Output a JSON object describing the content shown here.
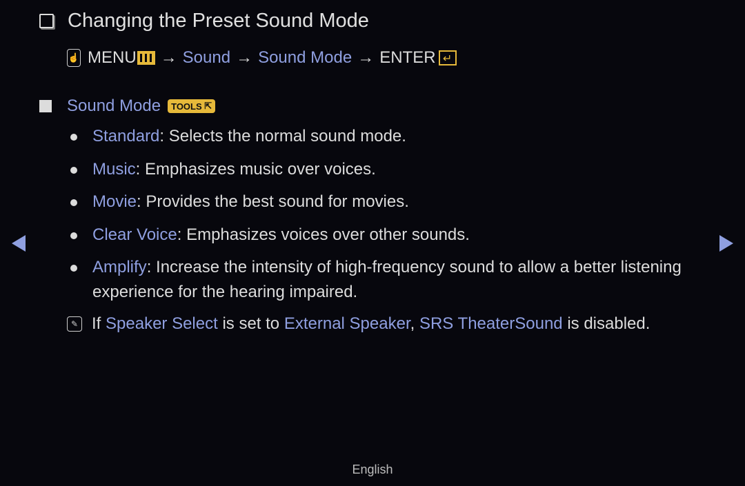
{
  "title": "Changing the Preset Sound Mode",
  "path": {
    "menu": "MENU",
    "arrow": "→",
    "step1": "Sound",
    "step2": "Sound Mode",
    "enter": "ENTER"
  },
  "section": {
    "label": "Sound Mode",
    "tools_badge": "TOOLS"
  },
  "items": [
    {
      "term": "Standard",
      "desc": ": Selects the normal sound mode."
    },
    {
      "term": "Music",
      "desc": ": Emphasizes music over voices."
    },
    {
      "term": "Movie",
      "desc": ": Provides the best sound for movies."
    },
    {
      "term": "Clear Voice",
      "desc": ": Emphasizes voices over other sounds."
    },
    {
      "term": "Amplify",
      "desc": ": Increase the intensity of high-frequency sound to allow a better listening experience for the hearing impaired."
    }
  ],
  "note": {
    "t1": "If ",
    "k1": "Speaker Select",
    "t2": " is set to ",
    "k2": "External Speaker",
    "t3": ", ",
    "k3": "SRS TheaterSound",
    "t4": " is disabled."
  },
  "footer": {
    "language": "English"
  },
  "colors": {
    "highlight": "#8f9fe0",
    "accent": "#e6b93a",
    "background": "#07070d"
  }
}
